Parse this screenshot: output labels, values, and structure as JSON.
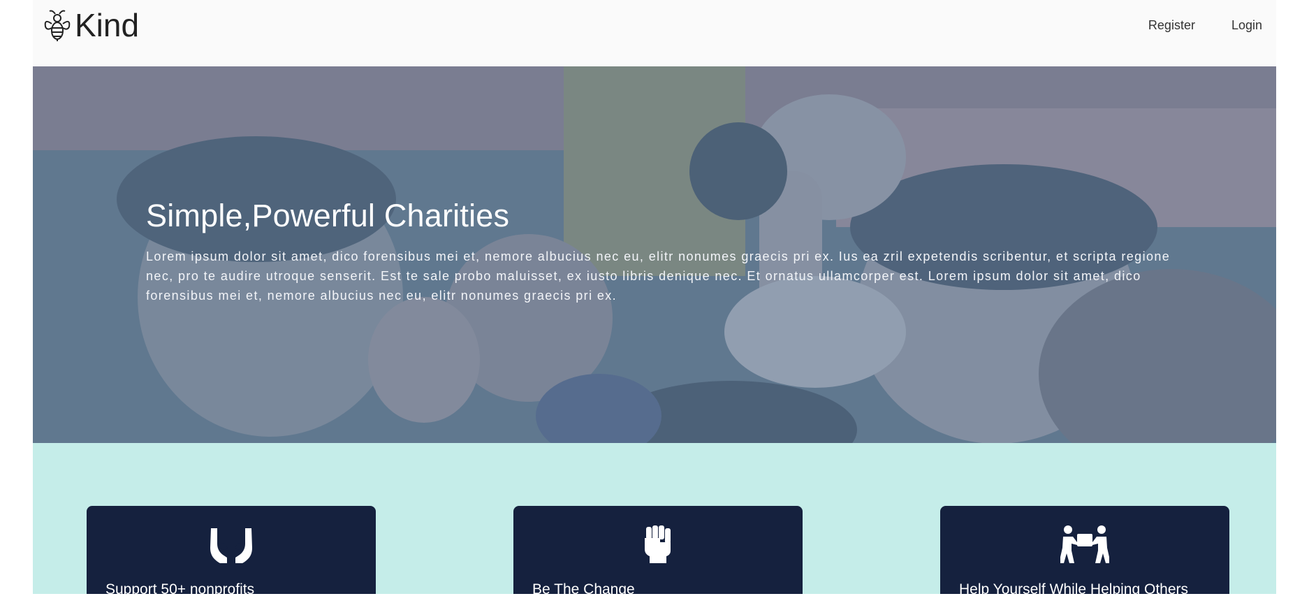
{
  "navbar": {
    "brand": "Kind",
    "brand_icon": "bee-icon",
    "links": [
      "Register",
      "Login"
    ]
  },
  "hero": {
    "title": "Simple,Powerful Charities",
    "text": "Lorem ipsum dolor sit amet, dico forensibus mei et, nemore albucius nec eu, elitr nonumes graecis pri ex. Ius ea zril expetendis scribentur, et scripta regione nec, pro te audire utroque senserit. Est te sale probo maluisset, ex iusto libris denique nec. Et ornatus ullamcorper est. Lorem ipsum dolor sit amet, dico forensibus mei et, nemore albucius nec eu, elitr nonumes graecis pri ex."
  },
  "features": {
    "background": "#c5ede9",
    "cards": [
      {
        "icon": "open-hands-icon",
        "title": "Support 50+ nonprofits"
      },
      {
        "icon": "raised-fist-icon",
        "title": "Be The Change"
      },
      {
        "icon": "people-carry-icon",
        "title": "Help Yourself While Helping Others"
      }
    ]
  },
  "colors": {
    "navbar_bg": "#fafafa",
    "card_bg": "#15213e",
    "features_bg": "#c5ede9",
    "hero_overlay": "#6f8497"
  }
}
